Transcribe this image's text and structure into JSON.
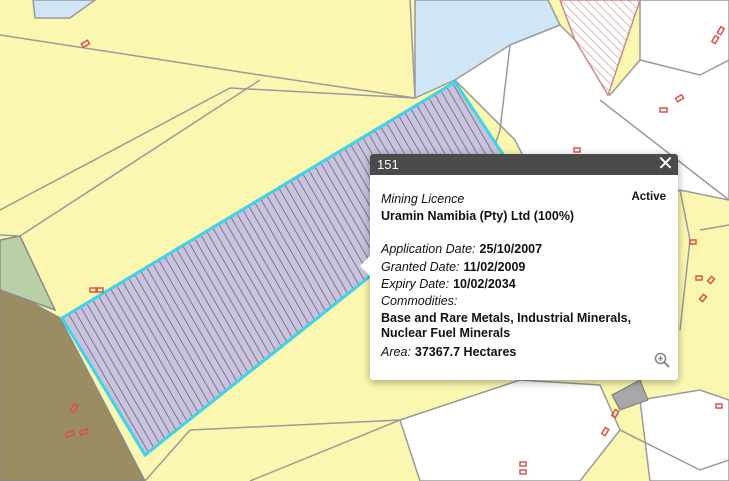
{
  "popup": {
    "title": "151",
    "status": "Active",
    "licence_type": "Mining Licence",
    "holder": "Uramin Namibia (Pty) Ltd (100%)",
    "application_label": "Application Date:",
    "application_date": "25/10/2007",
    "granted_label": "Granted Date:",
    "granted_date": "11/02/2009",
    "expiry_label": "Expiry Date:",
    "expiry_date": "10/02/2034",
    "commodities_label": "Commodities:",
    "commodities_line1": "Base and Rare Metals, Industrial Minerals,",
    "commodities_line2": "Nuclear Fuel Minerals",
    "area_label": "Area:",
    "area_value": "37367.7 Hectares",
    "close_icon": "close-icon",
    "zoom_icon": "zoom-in-icon"
  },
  "map": {
    "colors": {
      "parcel_fill": "#fbf6b0",
      "selected_outline": "#3fd3e8",
      "selected_hatch": "#b9b0cf",
      "water": "#cfe6f7",
      "olive": "#9a8d62",
      "green": "#b9cfa6"
    }
  }
}
